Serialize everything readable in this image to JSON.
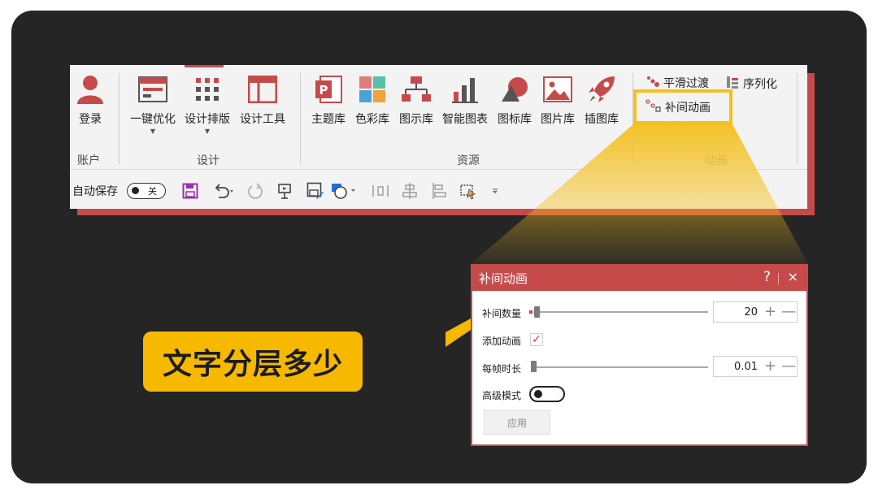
{
  "ribbon": {
    "account": {
      "login_label": "登录",
      "group_label": "账户"
    },
    "design": {
      "group_label": "设计",
      "one_click_optimize": "一键优化",
      "design_layout": "设计排版",
      "design_tools": "设计工具"
    },
    "resources": {
      "group_label": "资源",
      "theme_lib": "主题库",
      "color_lib": "色彩库",
      "diagram_lib": "图示库",
      "smart_chart": "智能图表",
      "icon_lib": "图标库",
      "picture_lib": "图片库",
      "illustration_lib": "插图库"
    },
    "animation": {
      "group_label": "动画",
      "smooth_transition": "平滑过渡",
      "serialize": "序列化",
      "tween_animation": "补间动画"
    }
  },
  "qat": {
    "autosave_label": "自动保存",
    "toggle_text": "关"
  },
  "dialog": {
    "title": "补间动画",
    "help": "?",
    "close": "×",
    "tween_count_label": "补间数量",
    "tween_count_value": "20",
    "add_animation_label": "添加动画",
    "add_animation_checked": true,
    "frame_duration_label": "每帧时长",
    "frame_duration_value": "0.01",
    "advanced_mode_label": "高级模式",
    "apply_label": "应用"
  },
  "callout": {
    "text": "文字分层多少"
  },
  "colors": {
    "accent_red": "#c74a4b",
    "highlight_yellow": "#f4c01d",
    "callout_yellow": "#f6b900",
    "frame_dark": "#252525"
  }
}
